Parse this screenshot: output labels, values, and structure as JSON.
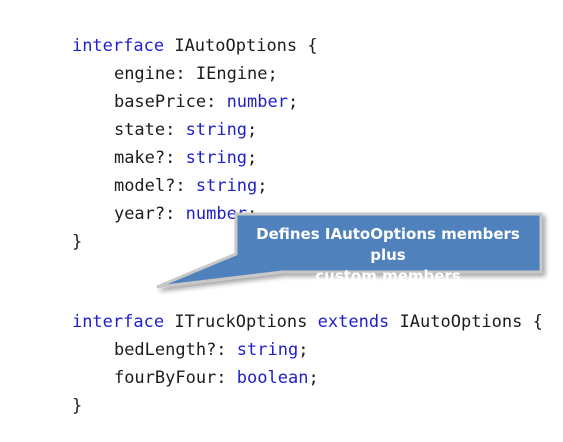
{
  "code": {
    "auto_interface": {
      "keyword": "interface",
      "name": "IAutoOptions {",
      "members": [
        {
          "name": "engine:",
          "type": "IEngine;",
          "type_is_keyword": false
        },
        {
          "name": "basePrice:",
          "type": "number",
          "type_is_keyword": true
        },
        {
          "name": "state:",
          "type": "string",
          "type_is_keyword": true
        },
        {
          "name": "make?:",
          "type": "string",
          "type_is_keyword": true
        },
        {
          "name": "model?:",
          "type": "string",
          "type_is_keyword": true
        },
        {
          "name": "year?:",
          "type": "number",
          "type_is_keyword": true
        }
      ],
      "close": "}"
    },
    "truck_interface": {
      "keyword": "interface",
      "name": "ITruckOptions",
      "extends_keyword": "extends",
      "base": "IAutoOptions {",
      "members": [
        {
          "name": "bedLength?:",
          "type": "string",
          "type_is_keyword": true
        },
        {
          "name": "fourByFour:",
          "type": "boolean",
          "type_is_keyword": true
        }
      ],
      "close": "}"
    },
    "semicolon": ";"
  },
  "callout": {
    "line1": "Defines IAutoOptions members plus",
    "line2": "custom members"
  },
  "colors": {
    "keyword": "#1e22c8",
    "text": "#1c1c1c",
    "callout_fill": "#4f81bd",
    "callout_border": "#c7c7c7"
  }
}
